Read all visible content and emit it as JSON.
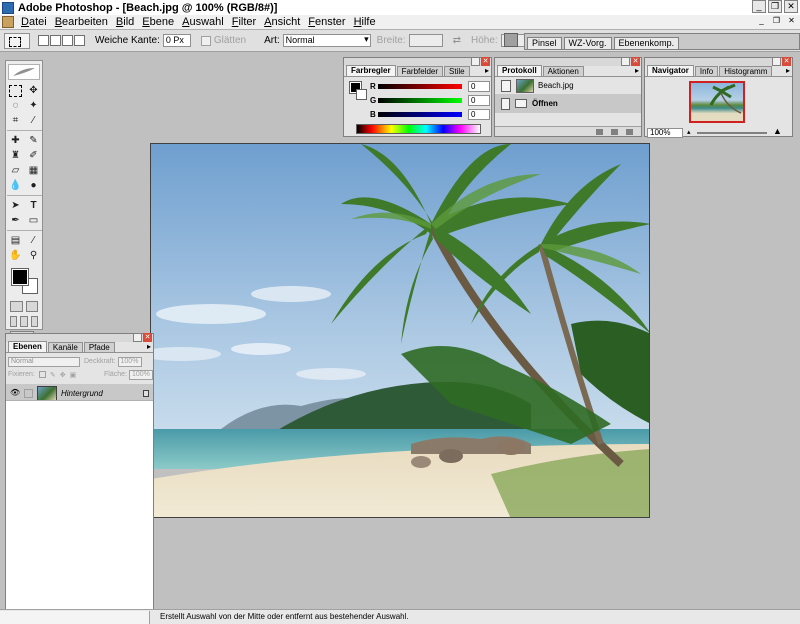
{
  "window": {
    "title": "Adobe Photoshop - [Beach.jpg @ 100% (RGB/8#)]",
    "buttons": [
      "_",
      "❐",
      "✕"
    ],
    "doc_buttons": [
      "_",
      "❐",
      "✕"
    ]
  },
  "menu": {
    "items": [
      {
        "u": "D",
        "rest": "atei"
      },
      {
        "u": "B",
        "rest": "earbeiten"
      },
      {
        "u": "B",
        "rest": "ild"
      },
      {
        "u": "E",
        "rest": "bene"
      },
      {
        "u": "A",
        "rest": "uswahl"
      },
      {
        "u": "F",
        "rest": "ilter"
      },
      {
        "u": "A",
        "rest": "nsicht"
      },
      {
        "u": "F",
        "rest": "enster"
      },
      {
        "u": "H",
        "rest": "ilfe"
      }
    ]
  },
  "options": {
    "feather_label": "Weiche Kante:",
    "feather_value": "0 Px",
    "smooth_label": "Glätten",
    "style_label": "Art:",
    "style_value": "Normal",
    "width_label": "Breite:",
    "height_label": "Höhe:"
  },
  "palette_well": {
    "tabs": [
      "Pinsel",
      "WZ-Vorg.",
      "Ebenenkomp."
    ]
  },
  "color_palette": {
    "tabs": [
      "Farbregler",
      "Farbfelder",
      "Stile"
    ],
    "sliders": [
      {
        "label": "R",
        "value": "0",
        "gradient": "linear-gradient(to right, #000, #ff0000)"
      },
      {
        "label": "G",
        "value": "0",
        "gradient": "linear-gradient(to right, #000, #00ff00)"
      },
      {
        "label": "B",
        "value": "0",
        "gradient": "linear-gradient(to right, #000, #0000ff)"
      }
    ]
  },
  "history_palette": {
    "tabs": [
      "Protokoll",
      "Aktionen"
    ],
    "snapshot": "Beach.jpg",
    "step": "Öffnen"
  },
  "navigator_palette": {
    "tabs": [
      "Navigator",
      "Info",
      "Histogramm"
    ],
    "zoom": "100%"
  },
  "layers_palette": {
    "tabs": [
      "Ebenen",
      "Kanäle",
      "Pfade"
    ],
    "blend_mode": "Normal",
    "opacity_label": "Deckkraft:",
    "opacity_value": "100%",
    "lock_label": "Fixieren:",
    "fill_label": "Fläche:",
    "fill_value": "100%",
    "layer_name": "Hintergrund"
  },
  "status": {
    "text": "Erstellt Auswahl von der Mitte oder entfernt aus bestehender Auswahl."
  },
  "colors": {
    "workspace": "#c0c0c0",
    "close_red": "#d84a3a",
    "nav_frame": "#d02020"
  }
}
